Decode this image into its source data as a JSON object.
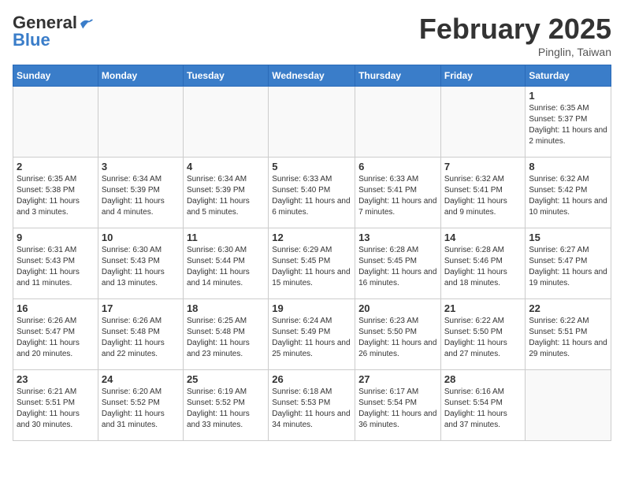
{
  "header": {
    "logo_general": "General",
    "logo_blue": "Blue",
    "month_title": "February 2025",
    "location": "Pinglin, Taiwan"
  },
  "weekdays": [
    "Sunday",
    "Monday",
    "Tuesday",
    "Wednesday",
    "Thursday",
    "Friday",
    "Saturday"
  ],
  "weeks": [
    [
      {
        "num": "",
        "info": ""
      },
      {
        "num": "",
        "info": ""
      },
      {
        "num": "",
        "info": ""
      },
      {
        "num": "",
        "info": ""
      },
      {
        "num": "",
        "info": ""
      },
      {
        "num": "",
        "info": ""
      },
      {
        "num": "1",
        "info": "Sunrise: 6:35 AM\nSunset: 5:37 PM\nDaylight: 11 hours and 2 minutes."
      }
    ],
    [
      {
        "num": "2",
        "info": "Sunrise: 6:35 AM\nSunset: 5:38 PM\nDaylight: 11 hours and 3 minutes."
      },
      {
        "num": "3",
        "info": "Sunrise: 6:34 AM\nSunset: 5:39 PM\nDaylight: 11 hours and 4 minutes."
      },
      {
        "num": "4",
        "info": "Sunrise: 6:34 AM\nSunset: 5:39 PM\nDaylight: 11 hours and 5 minutes."
      },
      {
        "num": "5",
        "info": "Sunrise: 6:33 AM\nSunset: 5:40 PM\nDaylight: 11 hours and 6 minutes."
      },
      {
        "num": "6",
        "info": "Sunrise: 6:33 AM\nSunset: 5:41 PM\nDaylight: 11 hours and 7 minutes."
      },
      {
        "num": "7",
        "info": "Sunrise: 6:32 AM\nSunset: 5:41 PM\nDaylight: 11 hours and 9 minutes."
      },
      {
        "num": "8",
        "info": "Sunrise: 6:32 AM\nSunset: 5:42 PM\nDaylight: 11 hours and 10 minutes."
      }
    ],
    [
      {
        "num": "9",
        "info": "Sunrise: 6:31 AM\nSunset: 5:43 PM\nDaylight: 11 hours and 11 minutes."
      },
      {
        "num": "10",
        "info": "Sunrise: 6:30 AM\nSunset: 5:43 PM\nDaylight: 11 hours and 13 minutes."
      },
      {
        "num": "11",
        "info": "Sunrise: 6:30 AM\nSunset: 5:44 PM\nDaylight: 11 hours and 14 minutes."
      },
      {
        "num": "12",
        "info": "Sunrise: 6:29 AM\nSunset: 5:45 PM\nDaylight: 11 hours and 15 minutes."
      },
      {
        "num": "13",
        "info": "Sunrise: 6:28 AM\nSunset: 5:45 PM\nDaylight: 11 hours and 16 minutes."
      },
      {
        "num": "14",
        "info": "Sunrise: 6:28 AM\nSunset: 5:46 PM\nDaylight: 11 hours and 18 minutes."
      },
      {
        "num": "15",
        "info": "Sunrise: 6:27 AM\nSunset: 5:47 PM\nDaylight: 11 hours and 19 minutes."
      }
    ],
    [
      {
        "num": "16",
        "info": "Sunrise: 6:26 AM\nSunset: 5:47 PM\nDaylight: 11 hours and 20 minutes."
      },
      {
        "num": "17",
        "info": "Sunrise: 6:26 AM\nSunset: 5:48 PM\nDaylight: 11 hours and 22 minutes."
      },
      {
        "num": "18",
        "info": "Sunrise: 6:25 AM\nSunset: 5:48 PM\nDaylight: 11 hours and 23 minutes."
      },
      {
        "num": "19",
        "info": "Sunrise: 6:24 AM\nSunset: 5:49 PM\nDaylight: 11 hours and 25 minutes."
      },
      {
        "num": "20",
        "info": "Sunrise: 6:23 AM\nSunset: 5:50 PM\nDaylight: 11 hours and 26 minutes."
      },
      {
        "num": "21",
        "info": "Sunrise: 6:22 AM\nSunset: 5:50 PM\nDaylight: 11 hours and 27 minutes."
      },
      {
        "num": "22",
        "info": "Sunrise: 6:22 AM\nSunset: 5:51 PM\nDaylight: 11 hours and 29 minutes."
      }
    ],
    [
      {
        "num": "23",
        "info": "Sunrise: 6:21 AM\nSunset: 5:51 PM\nDaylight: 11 hours and 30 minutes."
      },
      {
        "num": "24",
        "info": "Sunrise: 6:20 AM\nSunset: 5:52 PM\nDaylight: 11 hours and 31 minutes."
      },
      {
        "num": "25",
        "info": "Sunrise: 6:19 AM\nSunset: 5:52 PM\nDaylight: 11 hours and 33 minutes."
      },
      {
        "num": "26",
        "info": "Sunrise: 6:18 AM\nSunset: 5:53 PM\nDaylight: 11 hours and 34 minutes."
      },
      {
        "num": "27",
        "info": "Sunrise: 6:17 AM\nSunset: 5:54 PM\nDaylight: 11 hours and 36 minutes."
      },
      {
        "num": "28",
        "info": "Sunrise: 6:16 AM\nSunset: 5:54 PM\nDaylight: 11 hours and 37 minutes."
      },
      {
        "num": "",
        "info": ""
      }
    ]
  ]
}
